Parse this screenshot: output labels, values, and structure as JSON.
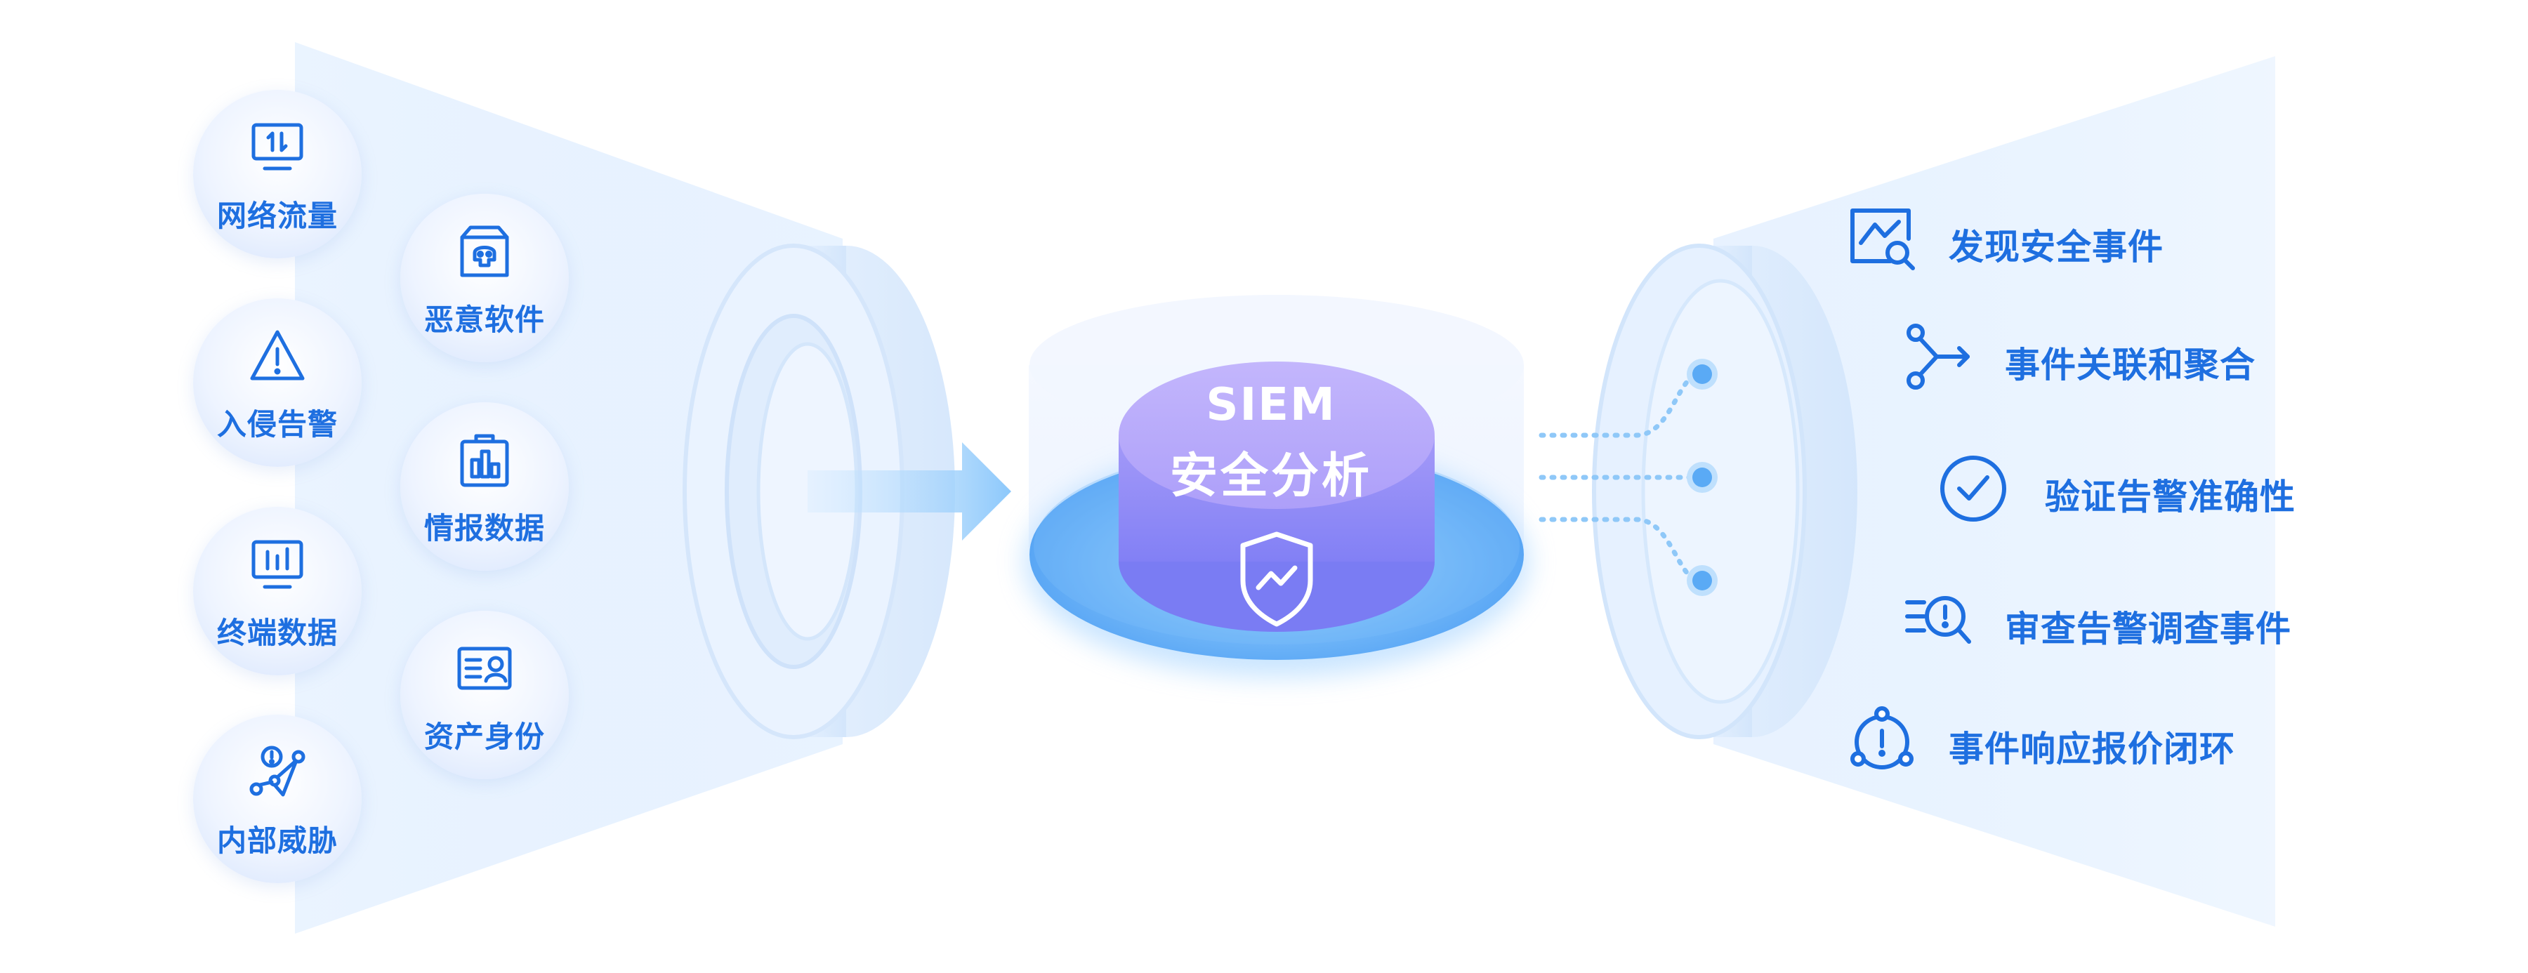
{
  "center": {
    "title": "SIEM",
    "subtitle": "安全分析"
  },
  "inputs": [
    {
      "label": "网络流量",
      "icon": "monitor-transfer-icon"
    },
    {
      "label": "入侵告警",
      "icon": "warning-triangle-icon"
    },
    {
      "label": "终端数据",
      "icon": "monitor-chart-icon"
    },
    {
      "label": "内部威胁",
      "icon": "threat-network-icon"
    },
    {
      "label": "恶意软件",
      "icon": "malware-box-icon"
    },
    {
      "label": "情报数据",
      "icon": "clipboard-chart-icon"
    },
    {
      "label": "资产身份",
      "icon": "id-card-icon"
    }
  ],
  "outputs": [
    {
      "label": "发现安全事件",
      "icon": "chart-search-icon"
    },
    {
      "label": "事件关联和聚合",
      "icon": "branch-icon"
    },
    {
      "label": "验证告警准确性",
      "icon": "check-circle-icon"
    },
    {
      "label": "审查告警调查事件",
      "icon": "list-search-icon"
    },
    {
      "label": "事件响应报价闭环",
      "icon": "alert-nodes-icon"
    }
  ],
  "colors": {
    "accent": "#1e6fe0",
    "cylinder_top": "#b7a8fb",
    "cylinder_body": "#8f89f7",
    "platform": "#5aaaf5"
  }
}
